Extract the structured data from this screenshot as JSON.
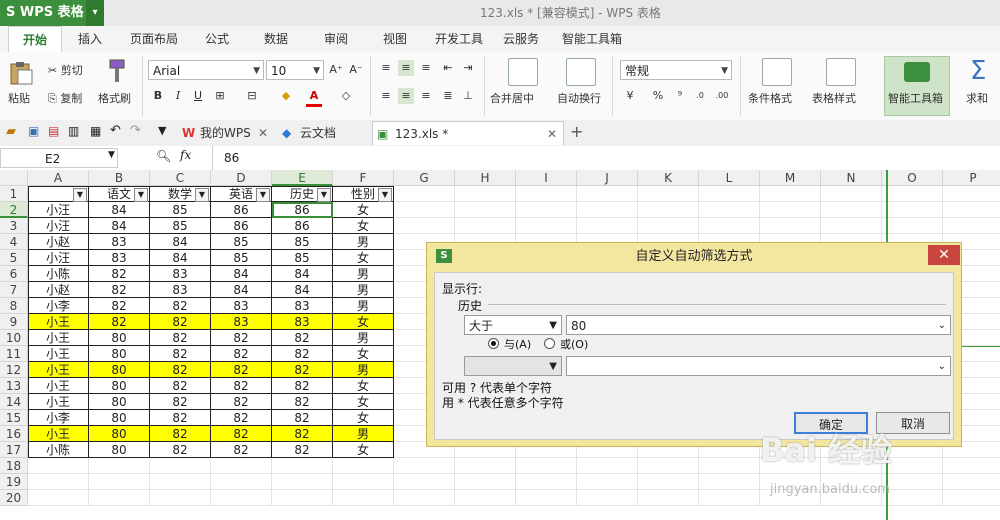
{
  "app": {
    "name": "S WPS 表格",
    "window_title": "123.xls * [兼容模式] - WPS 表格"
  },
  "ribbon_tabs": [
    "开始",
    "插入",
    "页面布局",
    "公式",
    "数据",
    "审阅",
    "视图",
    "开发工具",
    "云服务",
    "智能工具箱"
  ],
  "ribbon": {
    "cut": "剪切",
    "paste": "粘贴",
    "copy": "复制",
    "format_painter": "格式刷",
    "font_name": "Arial",
    "font_size": "10",
    "merge_center": "合并居中",
    "wrap": "自动换行",
    "number_format": "常规",
    "percent": "%",
    "comma": "⁹",
    "cond_format": "条件格式",
    "table_style": "表格样式",
    "smart_toolbox": "智能工具箱",
    "sum": "求和"
  },
  "doc_tabs": {
    "my_wps": "我的WPS",
    "cloud": "云文档",
    "file": "123.xls *"
  },
  "formula_bar": {
    "cell_ref": "E2",
    "fx": "fx",
    "value": "86"
  },
  "columns": [
    "A",
    "B",
    "C",
    "D",
    "E",
    "F",
    "G",
    "H",
    "I",
    "J",
    "K",
    "L",
    "M",
    "N",
    "O",
    "P"
  ],
  "rows": [
    "1",
    "2",
    "3",
    "4",
    "5",
    "6",
    "7",
    "8",
    "9",
    "10",
    "11",
    "12",
    "13",
    "14",
    "15",
    "16",
    "17",
    "18",
    "19",
    "20"
  ],
  "table": {
    "headers": [
      "",
      "语文",
      "数学",
      "英语",
      "历史",
      "性别"
    ],
    "rows": [
      {
        "cells": [
          "小汪",
          "84",
          "85",
          "86",
          "86",
          "女"
        ],
        "hl": false
      },
      {
        "cells": [
          "小汪",
          "84",
          "85",
          "86",
          "86",
          "女"
        ],
        "hl": false
      },
      {
        "cells": [
          "小赵",
          "83",
          "84",
          "85",
          "85",
          "男"
        ],
        "hl": false
      },
      {
        "cells": [
          "小汪",
          "83",
          "84",
          "85",
          "85",
          "女"
        ],
        "hl": false
      },
      {
        "cells": [
          "小陈",
          "82",
          "83",
          "84",
          "84",
          "男"
        ],
        "hl": false
      },
      {
        "cells": [
          "小赵",
          "82",
          "83",
          "84",
          "84",
          "男"
        ],
        "hl": false
      },
      {
        "cells": [
          "小李",
          "82",
          "82",
          "83",
          "83",
          "男"
        ],
        "hl": false
      },
      {
        "cells": [
          "小王",
          "82",
          "82",
          "83",
          "83",
          "女"
        ],
        "hl": true
      },
      {
        "cells": [
          "小王",
          "80",
          "82",
          "82",
          "82",
          "男"
        ],
        "hl": false
      },
      {
        "cells": [
          "小王",
          "80",
          "82",
          "82",
          "82",
          "女"
        ],
        "hl": false
      },
      {
        "cells": [
          "小王",
          "80",
          "82",
          "82",
          "82",
          "男"
        ],
        "hl": true
      },
      {
        "cells": [
          "小王",
          "80",
          "82",
          "82",
          "82",
          "女"
        ],
        "hl": false
      },
      {
        "cells": [
          "小王",
          "80",
          "82",
          "82",
          "82",
          "女"
        ],
        "hl": false
      },
      {
        "cells": [
          "小李",
          "80",
          "82",
          "82",
          "82",
          "女"
        ],
        "hl": false
      },
      {
        "cells": [
          "小王",
          "80",
          "82",
          "82",
          "82",
          "男"
        ],
        "hl": true
      },
      {
        "cells": [
          "小陈",
          "80",
          "82",
          "82",
          "82",
          "女"
        ],
        "hl": false
      }
    ]
  },
  "dialog": {
    "title": "自定义自动筛选方式",
    "show_rows": "显示行:",
    "field": "历史",
    "op1": "大于",
    "val1": "80",
    "and_label": "与(A)",
    "or_label": "或(O)",
    "op2": "",
    "val2": "",
    "hint1": "可用 ? 代表单个字符",
    "hint2": "用 * 代表任意多个字符",
    "ok": "确定",
    "cancel": "取消",
    "close": "✕"
  },
  "watermark": {
    "text": "Bai 经验",
    "sub": "jingyan.baidu.com"
  },
  "colors": {
    "accent": "#3c8f3c",
    "highlight": "#ffff00",
    "dialog_frame": "#f3e7a0",
    "close_red": "#c84540"
  }
}
